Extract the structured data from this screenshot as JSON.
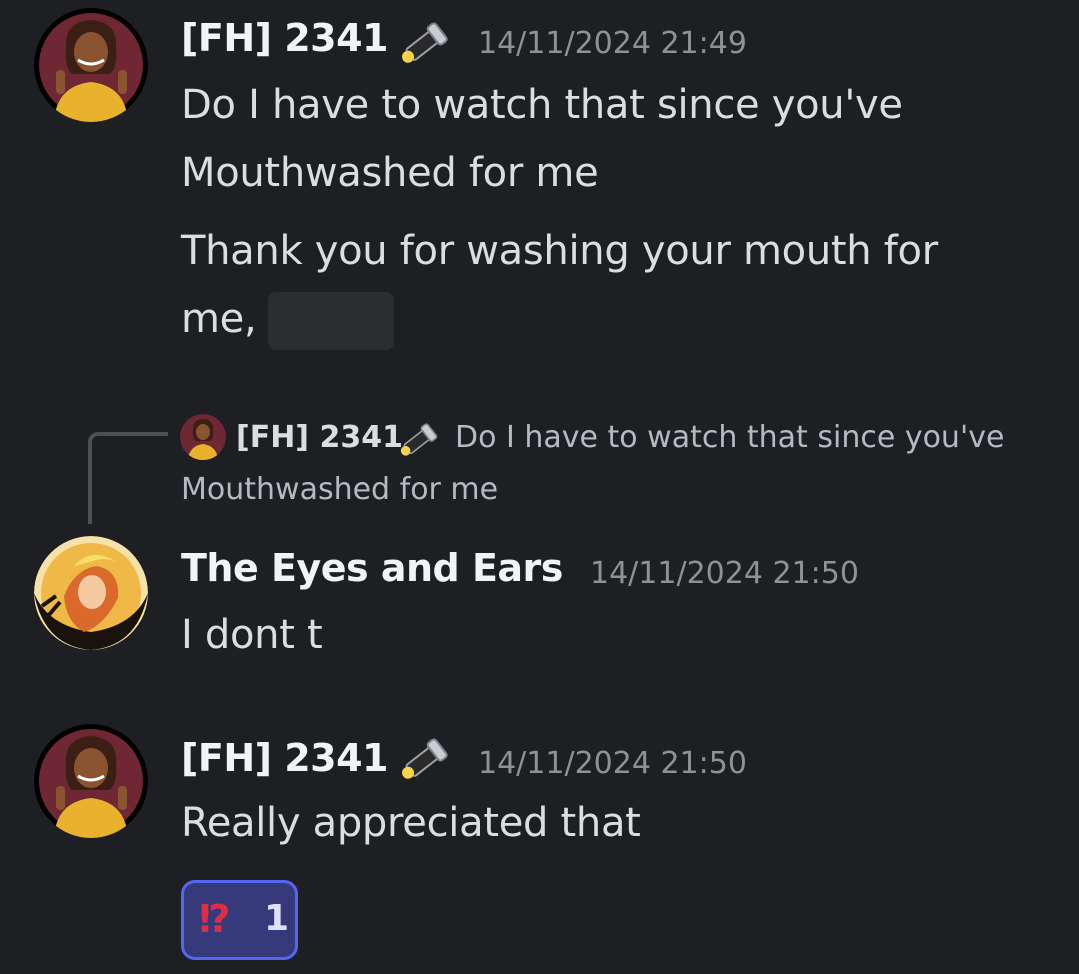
{
  "messages": [
    {
      "author": "[FH] 2341",
      "timestamp": "14/11/2024 21:49",
      "role_icon": "flashlight-icon",
      "avatar": "avatar-fh2341",
      "lines": [
        "Do I have to watch that since you've",
        "Mouthwashed for me"
      ],
      "followup_lines": [
        "Thank you for washing your mouth for",
        "me,"
      ],
      "spoiler": true
    },
    {
      "reply": {
        "author": "[FH] 2341",
        "role_icon": "flashlight-icon",
        "text_line1": "Do I have to watch that since you've",
        "text_line2": "Mouthwashed for me"
      },
      "author": "The Eyes and Ears",
      "timestamp": "14/11/2024 21:50",
      "avatar": "avatar-eyes-and-ears",
      "lines": [
        "I dont t"
      ]
    },
    {
      "author": "[FH] 2341",
      "timestamp": "14/11/2024 21:50",
      "role_icon": "flashlight-icon",
      "avatar": "avatar-fh2341",
      "lines": [
        "Really appreciated that"
      ],
      "reaction": {
        "emoji": "⁉",
        "count": "1"
      }
    }
  ],
  "colors": {
    "background": "#1e1f23",
    "name": "#f2f3f5",
    "text": "#dbdee1",
    "timestamp": "#8e9297",
    "reaction_bg": "#373a7a",
    "reaction_border": "#5865f2"
  }
}
